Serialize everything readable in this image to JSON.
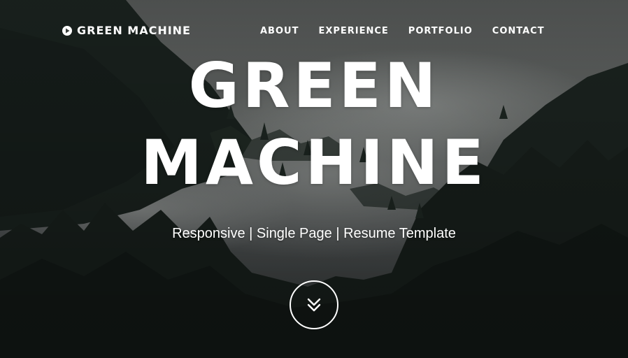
{
  "nav": {
    "brand": "GREEN MACHINE",
    "brand_icon": "play-circle-icon",
    "items": [
      {
        "label": "ABOUT"
      },
      {
        "label": "EXPERIENCE"
      },
      {
        "label": "PORTFOLIO"
      },
      {
        "label": "CONTACT"
      }
    ]
  },
  "hero": {
    "title_line1": "GREEN",
    "title_line2": "MACHINE",
    "subtitle": "Responsive | Single Page | Resume Template",
    "scroll_icon": "double-chevron-down-icon"
  },
  "colors": {
    "text": "#ffffff",
    "forest_dark": "#1c2622",
    "fog": "#8a8f8c"
  }
}
